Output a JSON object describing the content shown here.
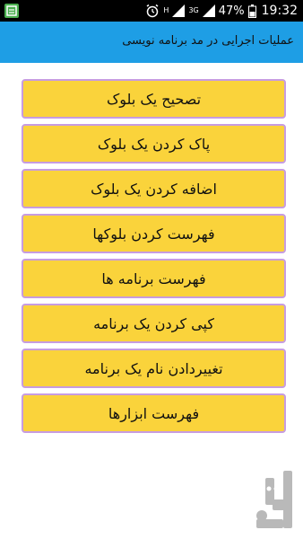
{
  "status_bar": {
    "signal_small_top": "H",
    "signal_small_bottom": "3G",
    "battery_percent": "47%",
    "time": "19:32"
  },
  "app_bar": {
    "title": "عملیات اجرایی در مد برنامه نویسی"
  },
  "menu": {
    "items": [
      {
        "label": "تصحیح یک بلوک"
      },
      {
        "label": "پاک کردن یک بلوک"
      },
      {
        "label": "اضافه کردن یک بلوک"
      },
      {
        "label": "فهرست کردن بلوکها"
      },
      {
        "label": "فهرست برنامه ها"
      },
      {
        "label": "کپی کردن یک برنامه"
      },
      {
        "label": "تغییردادن نام یک برنامه"
      },
      {
        "label": "فهرست ابزارها"
      }
    ]
  },
  "colors": {
    "status_bar": "#000000",
    "app_bar": "#1e9ee5",
    "button_fill": "#fad33b",
    "button_border": "#c79ce0",
    "logo": "#b9b9b9"
  }
}
